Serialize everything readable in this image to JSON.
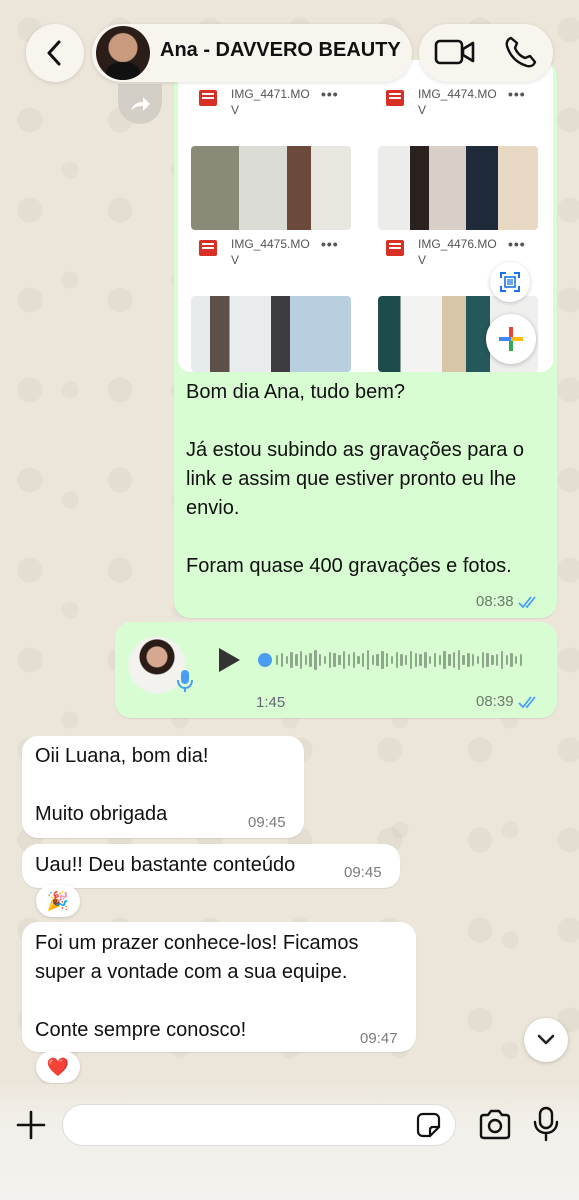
{
  "header": {
    "contact_name": "Ana - DAVVERO BEAUTY"
  },
  "media_album": {
    "files": [
      {
        "name": "IMG_4471.MO V"
      },
      {
        "name": "IMG_4474.MO V"
      },
      {
        "name": "IMG_4475.MO V"
      },
      {
        "name": "IMG_4476.MO V"
      }
    ],
    "more_label": "•••"
  },
  "outgoing_text": {
    "p1": "Bom dia Ana, tudo bem?",
    "p2": "Já estou subindo as gravações para o link e assim que estiver pronto eu lhe envio.",
    "p3": "Foram quase 400 gravações e fotos.",
    "time": "08:38",
    "status": "read"
  },
  "voice_note": {
    "duration": "1:45",
    "time": "08:39",
    "status": "read",
    "progress": 0
  },
  "incoming": [
    {
      "lines": [
        "Oii Luana, bom dia!",
        "",
        "Muito obrigada"
      ],
      "time": "09:45",
      "reaction": ""
    },
    {
      "lines": [
        "Uau!! Deu bastante conteúdo"
      ],
      "time": "09:45",
      "reaction": "🎉"
    },
    {
      "lines": [
        "Foi um prazer conhece-los! Ficamos super a vontade com a sua equipe.",
        "",
        "Conte sempre conosco!"
      ],
      "time": "09:47",
      "reaction": "❤️"
    }
  ],
  "composer": {
    "placeholder": ""
  },
  "colors": {
    "outgoing_bubble": "#d9fdd3",
    "incoming_bubble": "#ffffff",
    "read_ticks": "#4a9df0",
    "wallpaper": "#ece5da"
  }
}
